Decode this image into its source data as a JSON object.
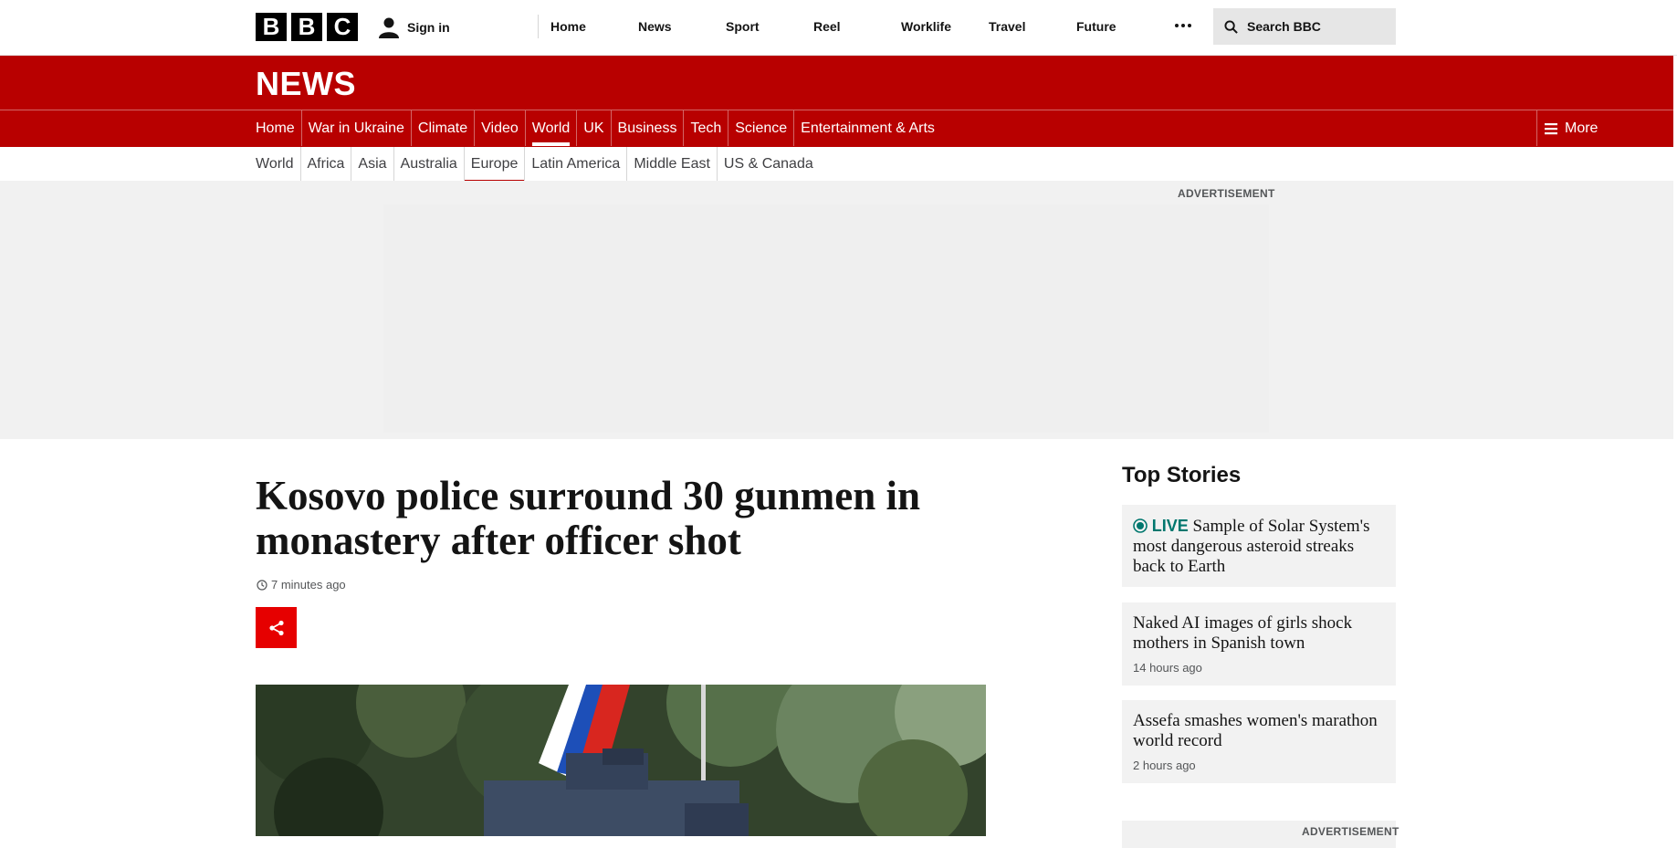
{
  "masthead": {
    "logo_letters": [
      "B",
      "B",
      "C"
    ],
    "signin_label": "Sign in",
    "nav": [
      "Home",
      "News",
      "Sport",
      "Reel",
      "Worklife",
      "Travel",
      "Future"
    ],
    "search_placeholder": "Search BBC"
  },
  "news": {
    "logo": "NEWS",
    "sections": [
      "Home",
      "War in Ukraine",
      "Climate",
      "Video",
      "World",
      "UK",
      "Business",
      "Tech",
      "Science",
      "Entertainment & Arts"
    ],
    "active_section": "World",
    "more_label": "More"
  },
  "subnav": {
    "items": [
      "World",
      "Africa",
      "Asia",
      "Australia",
      "Europe",
      "Latin America",
      "Middle East",
      "US & Canada"
    ],
    "active_item": "Europe"
  },
  "ads": {
    "top_label": "ADVERTISEMENT",
    "side_label": "ADVERTISEMENT"
  },
  "article": {
    "headline": "Kosovo police surround 30 gunmen in monastery after officer shot",
    "timestamp": "7 minutes ago"
  },
  "top_stories": {
    "title": "Top Stories",
    "items": [
      {
        "live": "LIVE",
        "title": "Sample of Solar System's most dangerous asteroid streaks back to Earth",
        "time": ""
      },
      {
        "live": "",
        "title": "Naked AI images of girls shock mothers in Spanish town",
        "time": "14 hours ago"
      },
      {
        "live": "",
        "title": "Assefa smashes women's marathon world record",
        "time": "2 hours ago"
      }
    ]
  },
  "colors": {
    "news_red": "#b80000",
    "share_red": "#e60000",
    "live_teal": "#00776e"
  }
}
